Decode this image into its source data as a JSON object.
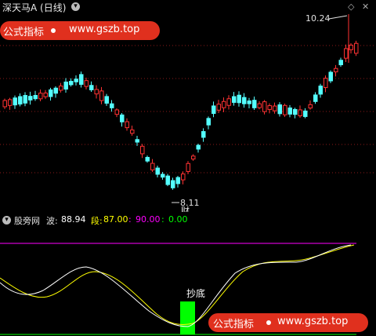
{
  "window": {
    "title": "深天马A (日线)"
  },
  "controls": {
    "minimize_glyph": "◇",
    "close_glyph": "✕"
  },
  "watermark": {
    "label": "公式指标",
    "url": "www.gszb.top"
  },
  "price_panel": {
    "high_label": "10.24",
    "low_label": "8.11",
    "low_marker": "财"
  },
  "indicator": {
    "name": "股旁网",
    "wave_label": "波:",
    "wave_value": "88.94",
    "seg_label": "段:",
    "seg_value": "87.00",
    "purple_value": "90.00",
    "green_value": "0.00",
    "signal_label": "抄底"
  },
  "colors": {
    "up": "#ff3232",
    "down": "#54ffff",
    "grid": "#8b1a1a",
    "white_line": "#ffffff",
    "yellow_line": "#ffff00",
    "purple": "#ff00ff",
    "green": "#00ff00",
    "badge": "#e0301e"
  }
}
